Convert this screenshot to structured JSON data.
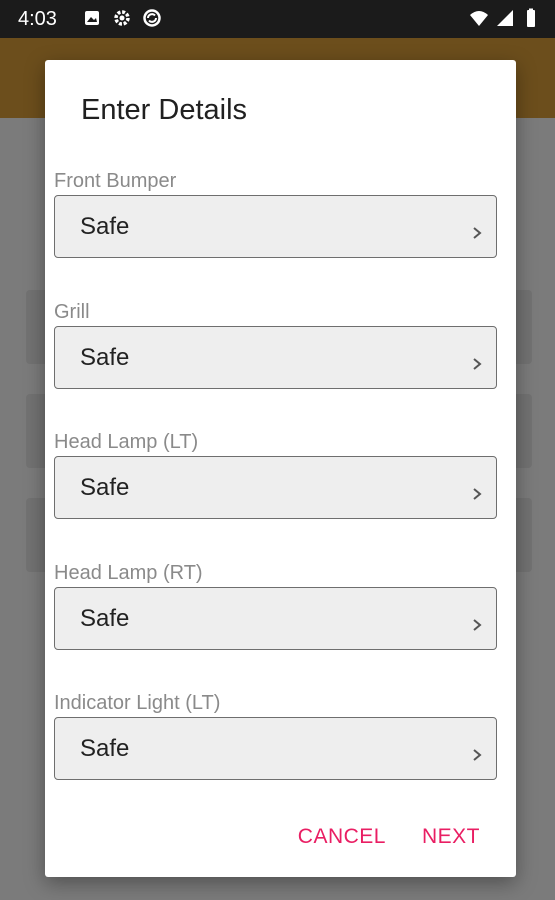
{
  "status_bar": {
    "time": "4:03",
    "left_icons": [
      "image-icon",
      "settings-gear-icon",
      "sync-icon"
    ],
    "right_icons": [
      "wifi-icon",
      "signal-icon",
      "battery-icon"
    ]
  },
  "dialog": {
    "title": "Enter Details",
    "fields": [
      {
        "label": "Front Bumper",
        "value": "Safe"
      },
      {
        "label": "Grill",
        "value": "Safe"
      },
      {
        "label": "Head Lamp (LT)",
        "value": "Safe"
      },
      {
        "label": "Head Lamp (RT)",
        "value": "Safe"
      },
      {
        "label": "Indicator Light (LT)",
        "value": "Safe"
      }
    ],
    "cancel_label": "CANCEL",
    "next_label": "NEXT"
  },
  "colors": {
    "accent": "#e91e63",
    "toolbar": "#a0742a"
  }
}
